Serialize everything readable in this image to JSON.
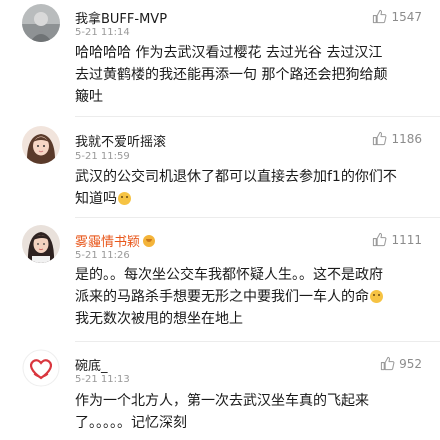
{
  "comments": [
    {
      "username": "我拿BUFF-MVP",
      "time": "5-21 11:14",
      "likes": "1547",
      "avatar_icon": "grey-portrait-avatar",
      "lines": [
        "哈哈哈哈  作为去武汉看过樱花  去过光谷  去过汉江",
        "去过黄鹤楼的我还能再添一句    那个路还会把狗给颠",
        "簸吐"
      ]
    },
    {
      "username": "我就不爱听摇滚",
      "time": "5-21 11:59",
      "likes": "1186",
      "avatar_icon": "girl-portrait-avatar",
      "lines": [
        "武汉的公交司机退休了都可以直接去参加f1的你们不",
        "知道吗"
      ],
      "emoji": "smile-emoji-icon"
    },
    {
      "username": "雾霾情书颖",
      "time": "5-21 11:26",
      "likes": "1111",
      "avatar_icon": "woman-portrait-avatar",
      "badge": "vip-badge-icon",
      "lines": [
        "是的。。每次坐公交车我都怀疑人生。。这不是政府",
        "派来的马路杀手想要无形之中要我们一车人的命",
        "我无数次被甩的想坐在地上"
      ],
      "emoji": "sad-emoji-icon"
    },
    {
      "username": "碗底_",
      "time": "5-21 11:13",
      "likes": "952",
      "avatar_icon": "heart-logo-avatar",
      "lines": [
        "作为一个北方人，第一次去武汉坐车真的飞起来",
        "了。。。。。记忆深刻"
      ]
    }
  ],
  "icons": {
    "like": "thumbs-up-icon"
  },
  "colors": {
    "vip_name": "#e8571b",
    "meta": "#999999",
    "text": "#1a1a1a"
  }
}
